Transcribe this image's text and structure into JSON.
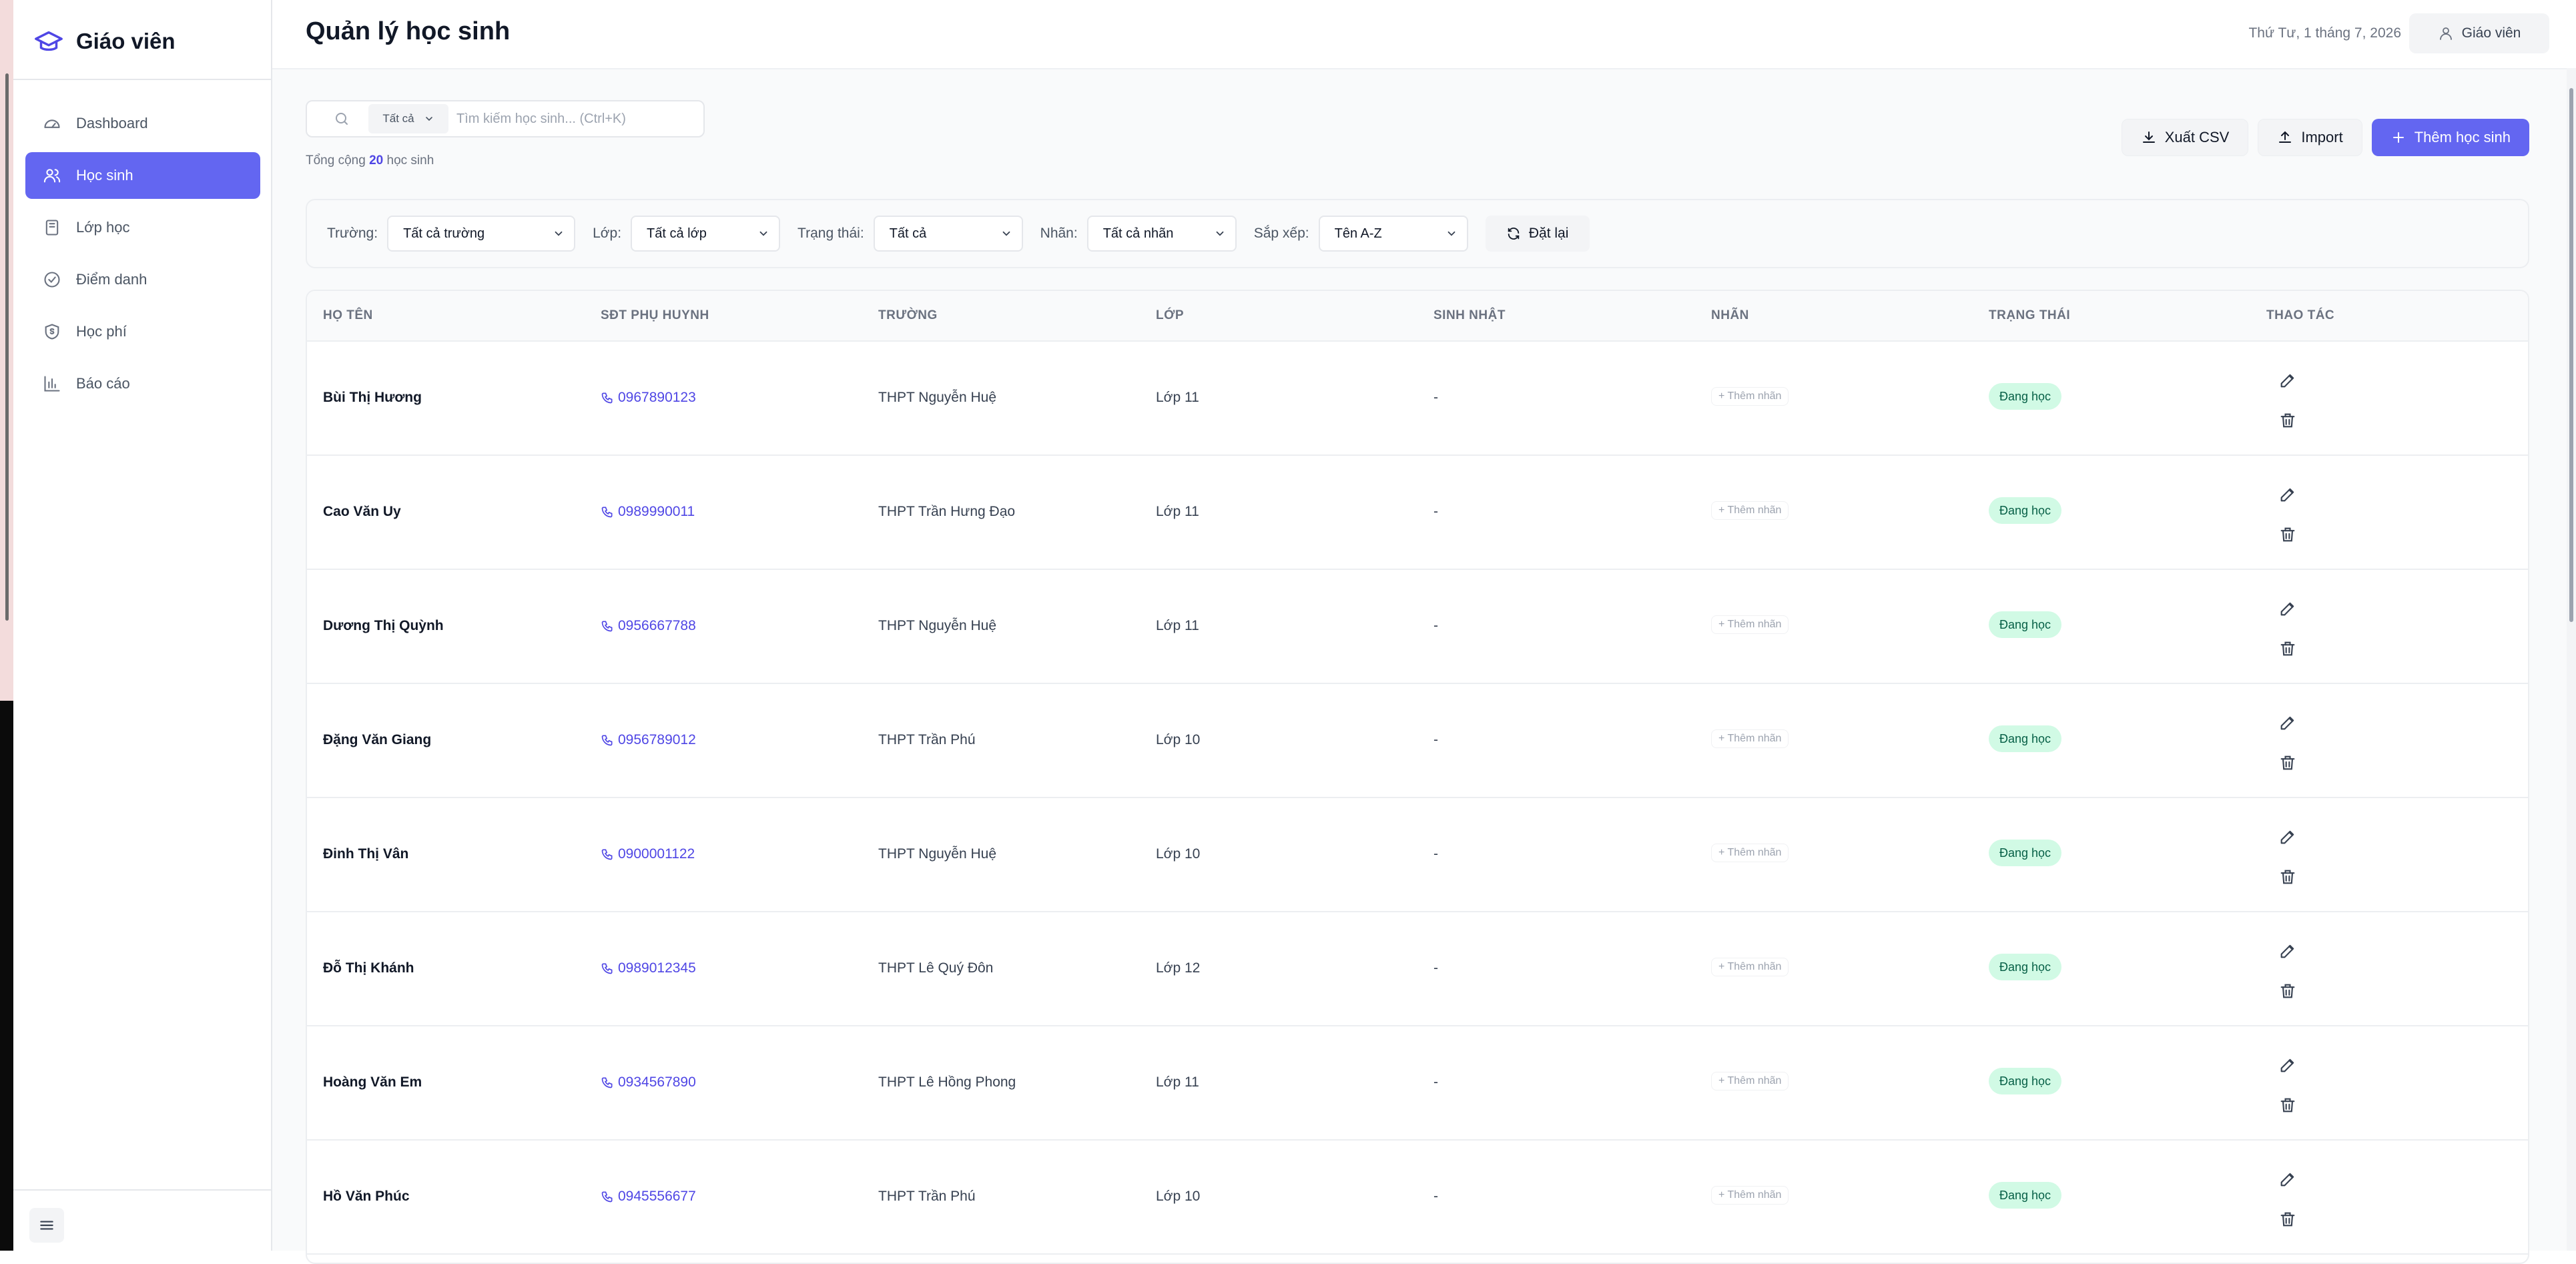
{
  "sidebar": {
    "brand_title": "Giáo viên",
    "items": [
      {
        "label": "Dashboard",
        "icon": "dashboard-icon",
        "active": false
      },
      {
        "label": "Học sinh",
        "icon": "users-icon",
        "active": true
      },
      {
        "label": "Lớp học",
        "icon": "book-icon",
        "active": false
      },
      {
        "label": "Điểm danh",
        "icon": "check-circle-icon",
        "active": false
      },
      {
        "label": "Học phí",
        "icon": "shield-dollar-icon",
        "active": false
      },
      {
        "label": "Báo cáo",
        "icon": "bar-chart-icon",
        "active": false
      }
    ]
  },
  "header": {
    "title": "Quản lý học sinh",
    "date": "Thứ Tư, 1 tháng 7, 2026",
    "user_label": "Giáo viên"
  },
  "search": {
    "scope": "Tất cả",
    "placeholder": "Tìm kiếm học sinh... (Ctrl+K)"
  },
  "summary": {
    "prefix": "Tổng cộng",
    "count": "20",
    "suffix": "học sinh"
  },
  "actions": {
    "export_label": "Xuất CSV",
    "import_label": "Import",
    "add_label": "Thêm học sinh"
  },
  "filters": {
    "school_label": "Trường:",
    "school_value": "Tất cả trường",
    "class_label": "Lớp:",
    "class_value": "Tất cả lớp",
    "status_label": "Trạng thái:",
    "status_value": "Tất cả",
    "tag_label": "Nhãn:",
    "tag_value": "Tất cả nhãn",
    "sort_label": "Sắp xếp:",
    "sort_value": "Tên A-Z",
    "reset_label": "Đặt lại"
  },
  "table": {
    "columns": [
      "HỌ TÊN",
      "SĐT PHỤ HUYNH",
      "TRƯỜNG",
      "LỚP",
      "SINH NHẬT",
      "NHÃN",
      "TRẠNG THÁI",
      "THAO TÁC"
    ],
    "rows": [
      {
        "name": "Bùi Thị Hương",
        "phone": "0967890123",
        "school": "THPT Nguyễn Huệ",
        "class": "Lớp 11",
        "birthday": "-",
        "tag": "+ Thêm nhãn",
        "status": "Đang học"
      },
      {
        "name": "Cao Văn Uy",
        "phone": "0989990011",
        "school": "THPT Trần Hưng Đạo",
        "class": "Lớp 11",
        "birthday": "-",
        "tag": "+ Thêm nhãn",
        "status": "Đang học"
      },
      {
        "name": "Dương Thị Quỳnh",
        "phone": "0956667788",
        "school": "THPT Nguyễn Huệ",
        "class": "Lớp 11",
        "birthday": "-",
        "tag": "+ Thêm nhãn",
        "status": "Đang học"
      },
      {
        "name": "Đặng Văn Giang",
        "phone": "0956789012",
        "school": "THPT Trần Phú",
        "class": "Lớp 10",
        "birthday": "-",
        "tag": "+ Thêm nhãn",
        "status": "Đang học"
      },
      {
        "name": "Đinh Thị Vân",
        "phone": "0900001122",
        "school": "THPT Nguyễn Huệ",
        "class": "Lớp 10",
        "birthday": "-",
        "tag": "+ Thêm nhãn",
        "status": "Đang học"
      },
      {
        "name": "Đỗ Thị Khánh",
        "phone": "0989012345",
        "school": "THPT Lê Quý Đôn",
        "class": "Lớp 12",
        "birthday": "-",
        "tag": "+ Thêm nhãn",
        "status": "Đang học"
      },
      {
        "name": "Hoàng Văn Em",
        "phone": "0934567890",
        "school": "THPT Lê Hồng Phong",
        "class": "Lớp 11",
        "birthday": "-",
        "tag": "+ Thêm nhãn",
        "status": "Đang học"
      },
      {
        "name": "Hồ Văn Phúc",
        "phone": "0945556677",
        "school": "THPT Trần Phú",
        "class": "Lớp 10",
        "birthday": "-",
        "tag": "+ Thêm nhãn",
        "status": "Đang học"
      }
    ]
  },
  "colors": {
    "accent": "#6366f1",
    "status_bg": "#d1fae5",
    "status_text": "#065f46"
  }
}
